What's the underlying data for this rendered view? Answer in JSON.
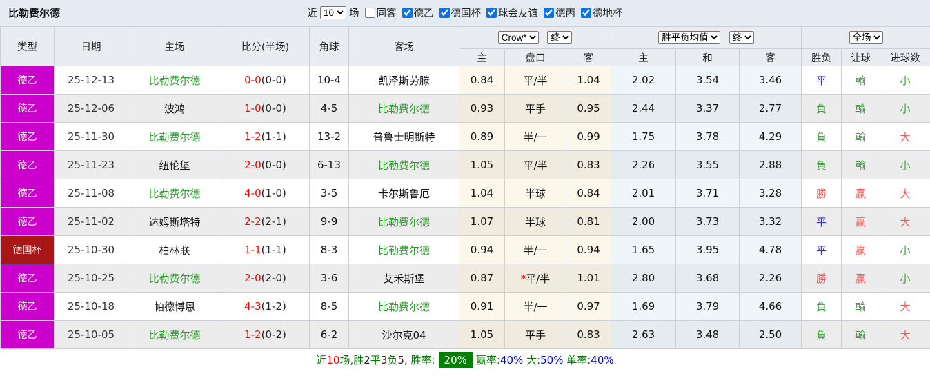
{
  "header": {
    "title": "比勒费尔德"
  },
  "filter": {
    "near_label": "近",
    "count_value": "10",
    "games_label": "场",
    "same_away": {
      "checked": false,
      "label": "同客"
    },
    "leagues": [
      {
        "checked": true,
        "label": "德乙"
      },
      {
        "checked": true,
        "label": "德国杯"
      },
      {
        "checked": true,
        "label": "球会友谊"
      },
      {
        "checked": true,
        "label": "德丙"
      },
      {
        "checked": true,
        "label": "德地杯"
      }
    ]
  },
  "table": {
    "columns": [
      "类型",
      "日期",
      "主场",
      "比分(半场)",
      "角球",
      "客场"
    ],
    "odds_group": {
      "bookmaker": "Crow*",
      "time": "终",
      "sub": [
        "主",
        "盘口",
        "客"
      ]
    },
    "mean_group": {
      "label": "胜平负均值",
      "time": "终",
      "sub": [
        "主",
        "和",
        "客"
      ]
    },
    "result_group": {
      "label": "全场",
      "sub": [
        "胜负",
        "让球",
        "进球数"
      ]
    },
    "rows": [
      {
        "type": "德乙",
        "type_style": "league",
        "date": "25-12-13",
        "home": "比勒费尔德",
        "home_self": true,
        "score": "0-0",
        "half": "(0-0)",
        "corner": "10-4",
        "away": "凯泽斯劳滕",
        "away_self": false,
        "odds": [
          "0.84",
          "平/半",
          "1.04"
        ],
        "star": false,
        "mean": [
          "2.02",
          "3.54",
          "3.46"
        ],
        "result": [
          {
            "t": "平",
            "c": "blue"
          },
          {
            "t": "輸",
            "c": "green"
          },
          {
            "t": "小",
            "c": "green"
          }
        ]
      },
      {
        "type": "德乙",
        "type_style": "league",
        "date": "25-12-06",
        "home": "波鸿",
        "home_self": false,
        "score": "1-0",
        "half": "(0-0)",
        "corner": "4-5",
        "away": "比勒费尔德",
        "away_self": true,
        "odds": [
          "0.93",
          "平手",
          "0.95"
        ],
        "star": false,
        "mean": [
          "2.44",
          "3.37",
          "2.77"
        ],
        "result": [
          {
            "t": "負",
            "c": "green"
          },
          {
            "t": "輸",
            "c": "green"
          },
          {
            "t": "小",
            "c": "green"
          }
        ]
      },
      {
        "type": "德乙",
        "type_style": "league",
        "date": "25-11-30",
        "home": "比勒费尔德",
        "home_self": true,
        "score": "1-2",
        "half": "(1-1)",
        "corner": "13-2",
        "away": "普鲁士明斯特",
        "away_self": false,
        "odds": [
          "0.89",
          "半/一",
          "0.99"
        ],
        "star": false,
        "mean": [
          "1.75",
          "3.78",
          "4.29"
        ],
        "result": [
          {
            "t": "負",
            "c": "green"
          },
          {
            "t": "輸",
            "c": "green"
          },
          {
            "t": "大",
            "c": "red"
          }
        ]
      },
      {
        "type": "德乙",
        "type_style": "league",
        "date": "25-11-23",
        "home": "纽伦堡",
        "home_self": false,
        "score": "2-0",
        "half": "(0-0)",
        "corner": "6-13",
        "away": "比勒费尔德",
        "away_self": true,
        "odds": [
          "1.05",
          "平/半",
          "0.83"
        ],
        "star": false,
        "mean": [
          "2.26",
          "3.55",
          "2.88"
        ],
        "result": [
          {
            "t": "負",
            "c": "green"
          },
          {
            "t": "輸",
            "c": "green"
          },
          {
            "t": "小",
            "c": "green"
          }
        ]
      },
      {
        "type": "德乙",
        "type_style": "league",
        "date": "25-11-08",
        "home": "比勒费尔德",
        "home_self": true,
        "score": "4-0",
        "half": "(1-0)",
        "corner": "3-5",
        "away": "卡尔斯鲁厄",
        "away_self": false,
        "odds": [
          "1.04",
          "半球",
          "0.84"
        ],
        "star": false,
        "mean": [
          "2.01",
          "3.71",
          "3.28"
        ],
        "result": [
          {
            "t": "勝",
            "c": "red"
          },
          {
            "t": "贏",
            "c": "red"
          },
          {
            "t": "大",
            "c": "red"
          }
        ]
      },
      {
        "type": "德乙",
        "type_style": "league",
        "date": "25-11-02",
        "home": "达姆斯塔特",
        "home_self": false,
        "score": "2-2",
        "half": "(2-1)",
        "corner": "9-9",
        "away": "比勒费尔德",
        "away_self": true,
        "odds": [
          "1.07",
          "半球",
          "0.81"
        ],
        "star": false,
        "mean": [
          "2.00",
          "3.73",
          "3.32"
        ],
        "result": [
          {
            "t": "平",
            "c": "blue"
          },
          {
            "t": "贏",
            "c": "red"
          },
          {
            "t": "大",
            "c": "red"
          }
        ]
      },
      {
        "type": "德国杯",
        "type_style": "cup",
        "date": "25-10-30",
        "home": "柏林联",
        "home_self": false,
        "score": "1-1",
        "half": "(1-1)",
        "corner": "8-3",
        "away": "比勒费尔德",
        "away_self": true,
        "odds": [
          "0.94",
          "半/一",
          "0.94"
        ],
        "star": false,
        "mean": [
          "1.65",
          "3.95",
          "4.78"
        ],
        "result": [
          {
            "t": "平",
            "c": "blue"
          },
          {
            "t": "贏",
            "c": "red"
          },
          {
            "t": "小",
            "c": "green"
          }
        ]
      },
      {
        "type": "德乙",
        "type_style": "league",
        "date": "25-10-25",
        "home": "比勒费尔德",
        "home_self": true,
        "score": "2-0",
        "half": "(2-0)",
        "corner": "3-6",
        "away": "艾禾斯堡",
        "away_self": false,
        "odds": [
          "0.87",
          "平/半",
          "1.01"
        ],
        "star": true,
        "mean": [
          "2.80",
          "3.68",
          "2.26"
        ],
        "result": [
          {
            "t": "勝",
            "c": "red"
          },
          {
            "t": "贏",
            "c": "red"
          },
          {
            "t": "小",
            "c": "green"
          }
        ]
      },
      {
        "type": "德乙",
        "type_style": "league",
        "date": "25-10-18",
        "home": "帕德博恩",
        "home_self": false,
        "score": "4-3",
        "half": "(1-2)",
        "corner": "8-5",
        "away": "比勒费尔德",
        "away_self": true,
        "odds": [
          "0.91",
          "半/一",
          "0.97"
        ],
        "star": false,
        "mean": [
          "1.69",
          "3.79",
          "4.66"
        ],
        "result": [
          {
            "t": "負",
            "c": "green"
          },
          {
            "t": "輸",
            "c": "green"
          },
          {
            "t": "大",
            "c": "red"
          }
        ]
      },
      {
        "type": "德乙",
        "type_style": "league",
        "date": "25-10-05",
        "home": "比勒费尔德",
        "home_self": true,
        "score": "1-2",
        "half": "(0-2)",
        "corner": "6-2",
        "away": "沙尔克04",
        "away_self": false,
        "odds": [
          "1.05",
          "平手",
          "0.83"
        ],
        "star": false,
        "mean": [
          "2.63",
          "3.48",
          "2.50"
        ],
        "result": [
          {
            "t": "負",
            "c": "green"
          },
          {
            "t": "輸",
            "c": "green"
          },
          {
            "t": "大",
            "c": "red"
          }
        ]
      }
    ]
  },
  "summary": {
    "segments": [
      {
        "t": "近",
        "c": "green"
      },
      {
        "t": "10",
        "c": "red"
      },
      {
        "t": "场,",
        "c": "green"
      },
      {
        "t": "胜",
        "c": "green"
      },
      {
        "t": "2",
        "c": "dark"
      },
      {
        "t": "平",
        "c": "green"
      },
      {
        "t": "3",
        "c": "dark"
      },
      {
        "t": "负",
        "c": "green"
      },
      {
        "t": "5",
        "c": "dark"
      },
      {
        "t": ", ",
        "c": "dark"
      },
      {
        "t": "胜率:",
        "c": "green"
      },
      {
        "t": "20%",
        "c": "badge"
      },
      {
        "t": "赢率:",
        "c": "green"
      },
      {
        "t": "40%",
        "c": "blue"
      },
      {
        "t": " 大:",
        "c": "green"
      },
      {
        "t": "50%",
        "c": "blue"
      },
      {
        "t": " 单率:",
        "c": "green"
      },
      {
        "t": "40%",
        "c": "blue"
      }
    ]
  },
  "colors": {
    "league_type_bg": "#cc00cc",
    "cup_type_bg": "#a81616",
    "self_team_green": "#2e9b2e",
    "score_red": "#ff0000",
    "result_win_red": "#ef5a5a",
    "result_draw_blue": "#3939d0",
    "result_loss_green": "#3f9e3f",
    "summary_label_green": "#008000",
    "summary_value_blue": "#0000ee",
    "win_rate_badge_bg": "#008000",
    "checkbox_blue": "#0b74e4",
    "filter_bar_bg": "#e4ebf3",
    "header_bg": "#e9edf2",
    "alt_row_bg": "#ececec",
    "handicap_col_bg": "#fbf7ea",
    "mean_col_bg": "#eef6fa"
  }
}
